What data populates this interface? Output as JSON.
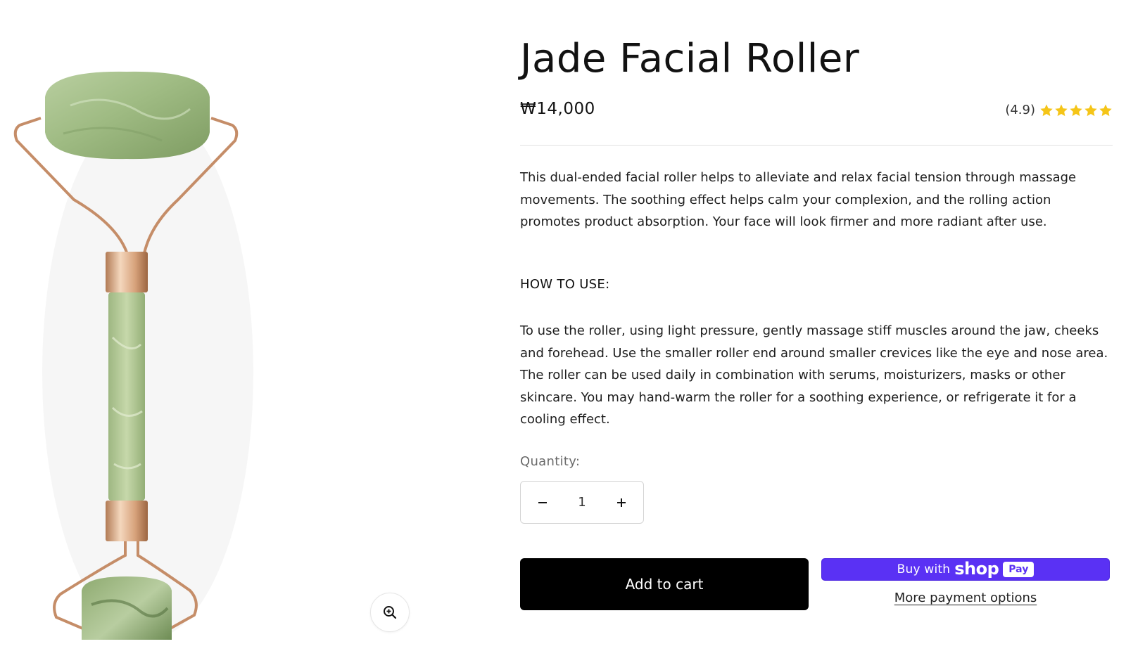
{
  "product": {
    "title": "Jade Facial Roller",
    "price": "₩14,000",
    "rating_text": "(4.9)",
    "rating_value": 4.9,
    "rating_max": 5,
    "star_color": "#f5c518",
    "description_1": "This dual-ended facial roller helps to alleviate and relax facial tension through massage movements. The soothing effect helps calm your complexion, and the rolling action promotes product absorption. Your face will look firmer and more radiant after use.",
    "how_to_heading": "HOW TO USE:",
    "description_2": "To use the roller, using light pressure, gently massage stiff muscles around the jaw, cheeks and forehead. Use the smaller roller end around smaller crevices like the eye and nose area. The roller can be used daily in combination with serums, moisturizers, masks or other skincare. You may hand-warm the roller for a soothing experience, or refrigerate it for a cooling effect."
  },
  "quantity": {
    "label": "Quantity:",
    "value": "1",
    "decrease_icon": "minus-icon",
    "increase_icon": "plus-icon"
  },
  "actions": {
    "add_to_cart": "Add to cart",
    "shop_pay_prefix": "Buy with",
    "shop_pay_brand": "shop",
    "shop_pay_badge": "Pay",
    "shop_pay_color": "#5a31f4",
    "more_payment": "More payment options"
  },
  "media": {
    "image_alt": "jade facial roller",
    "zoom_icon": "zoom-in-icon"
  }
}
